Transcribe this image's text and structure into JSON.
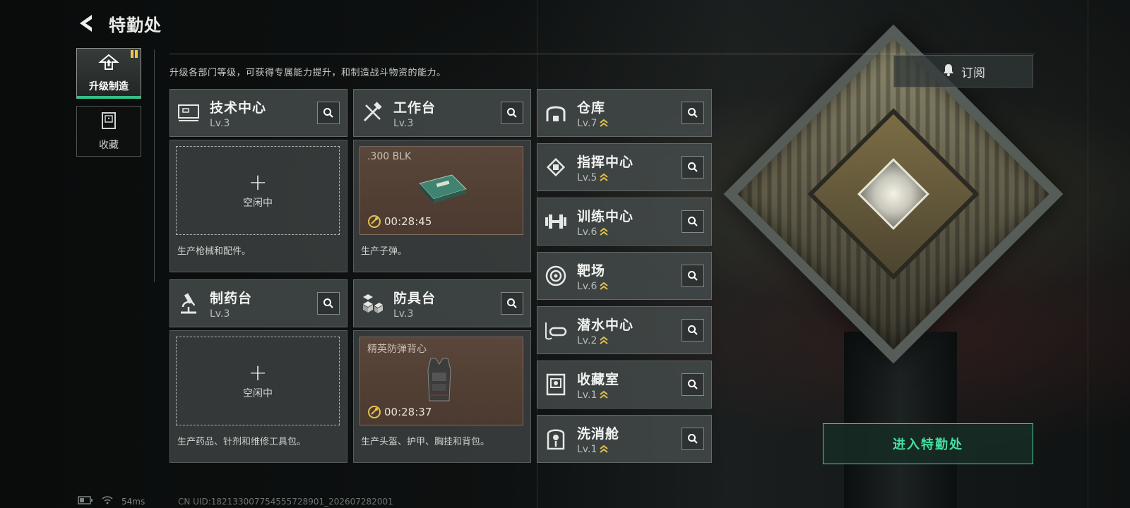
{
  "header": {
    "title": "特勤处"
  },
  "nav": [
    {
      "label": "升级制造",
      "icon": "upgrade-icon",
      "active": true
    },
    {
      "label": "收藏",
      "icon": "collection-icon",
      "active": false
    }
  ],
  "intro": "升级各部门等级，可获得专属能力提升，和制造战斗物资的能力。",
  "subscribe_label": "订阅",
  "facilities": [
    {
      "name": "技术中心",
      "level": "Lv.3",
      "icon": "computer-icon",
      "slot": {
        "state": "idle",
        "label": "空闲中"
      },
      "desc": "生产枪械和配件。"
    },
    {
      "name": "工作台",
      "level": "Lv.3",
      "icon": "tools-icon",
      "slot": {
        "state": "producing",
        "item": ".300 BLK",
        "timer": "00:28:45"
      },
      "desc": "生产子弹。"
    },
    {
      "name": "制药台",
      "level": "Lv.3",
      "icon": "microscope-icon",
      "slot": {
        "state": "idle",
        "label": "空闲中"
      },
      "desc": "生产药品、针剂和维修工具包。"
    },
    {
      "name": "防具台",
      "level": "Lv.3",
      "icon": "armor-blocks-icon",
      "slot": {
        "state": "producing",
        "item": "精英防弹背心",
        "timer": "00:28:37"
      },
      "desc": "生产头盔、护甲、胸挂和背包。"
    }
  ],
  "departments": [
    {
      "name": "仓库",
      "level": "Lv.7",
      "icon": "warehouse-icon"
    },
    {
      "name": "指挥中心",
      "level": "Lv.5",
      "icon": "chip-icon"
    },
    {
      "name": "训练中心",
      "level": "Lv.6",
      "icon": "dumbbell-icon"
    },
    {
      "name": "靶场",
      "level": "Lv.6",
      "icon": "target-icon"
    },
    {
      "name": "潜水中心",
      "level": "Lv.2",
      "icon": "diving-mask-icon"
    },
    {
      "name": "收藏室",
      "level": "Lv.1",
      "icon": "collection-room-icon"
    },
    {
      "name": "洗消舱",
      "level": "Lv.1",
      "icon": "decon-icon"
    }
  ],
  "enter_button": "进入特勤处",
  "status": {
    "ping": "54ms",
    "uid": "CN UID:18213300775455572890​1_202607282001"
  },
  "colors": {
    "accent": "#3fd69a",
    "upgrade_chevron": "#e3c24a",
    "timer": "#e3c24a"
  }
}
